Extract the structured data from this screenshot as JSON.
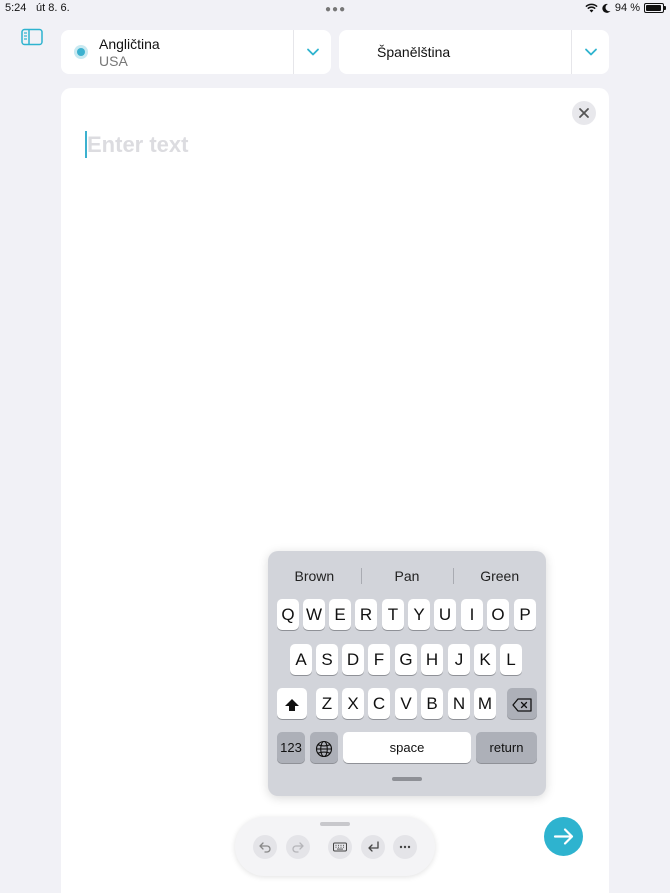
{
  "status_bar": {
    "time": "5:24",
    "date": "út 8. 6.",
    "battery": "94 %",
    "battery_level": 0.94
  },
  "language_selector": {
    "source": {
      "language": "Angličtina",
      "variant": "USA"
    },
    "target": {
      "language": "Španělština"
    }
  },
  "editor": {
    "placeholder": "Enter text"
  },
  "keyboard": {
    "suggestions": [
      "Brown",
      "Pan",
      "Green"
    ],
    "row1": [
      "Q",
      "W",
      "E",
      "R",
      "T",
      "Y",
      "U",
      "I",
      "O",
      "P"
    ],
    "row2": [
      "A",
      "S",
      "D",
      "F",
      "G",
      "H",
      "J",
      "K",
      "L"
    ],
    "row3": [
      "Z",
      "X",
      "C",
      "V",
      "B",
      "N",
      "M"
    ],
    "numbers_label": "123",
    "space_label": "space",
    "return_label": "return"
  },
  "colors": {
    "accent": "#2eb3cf",
    "background": "#f1f1f6",
    "keyboard": "#d2d4da"
  }
}
